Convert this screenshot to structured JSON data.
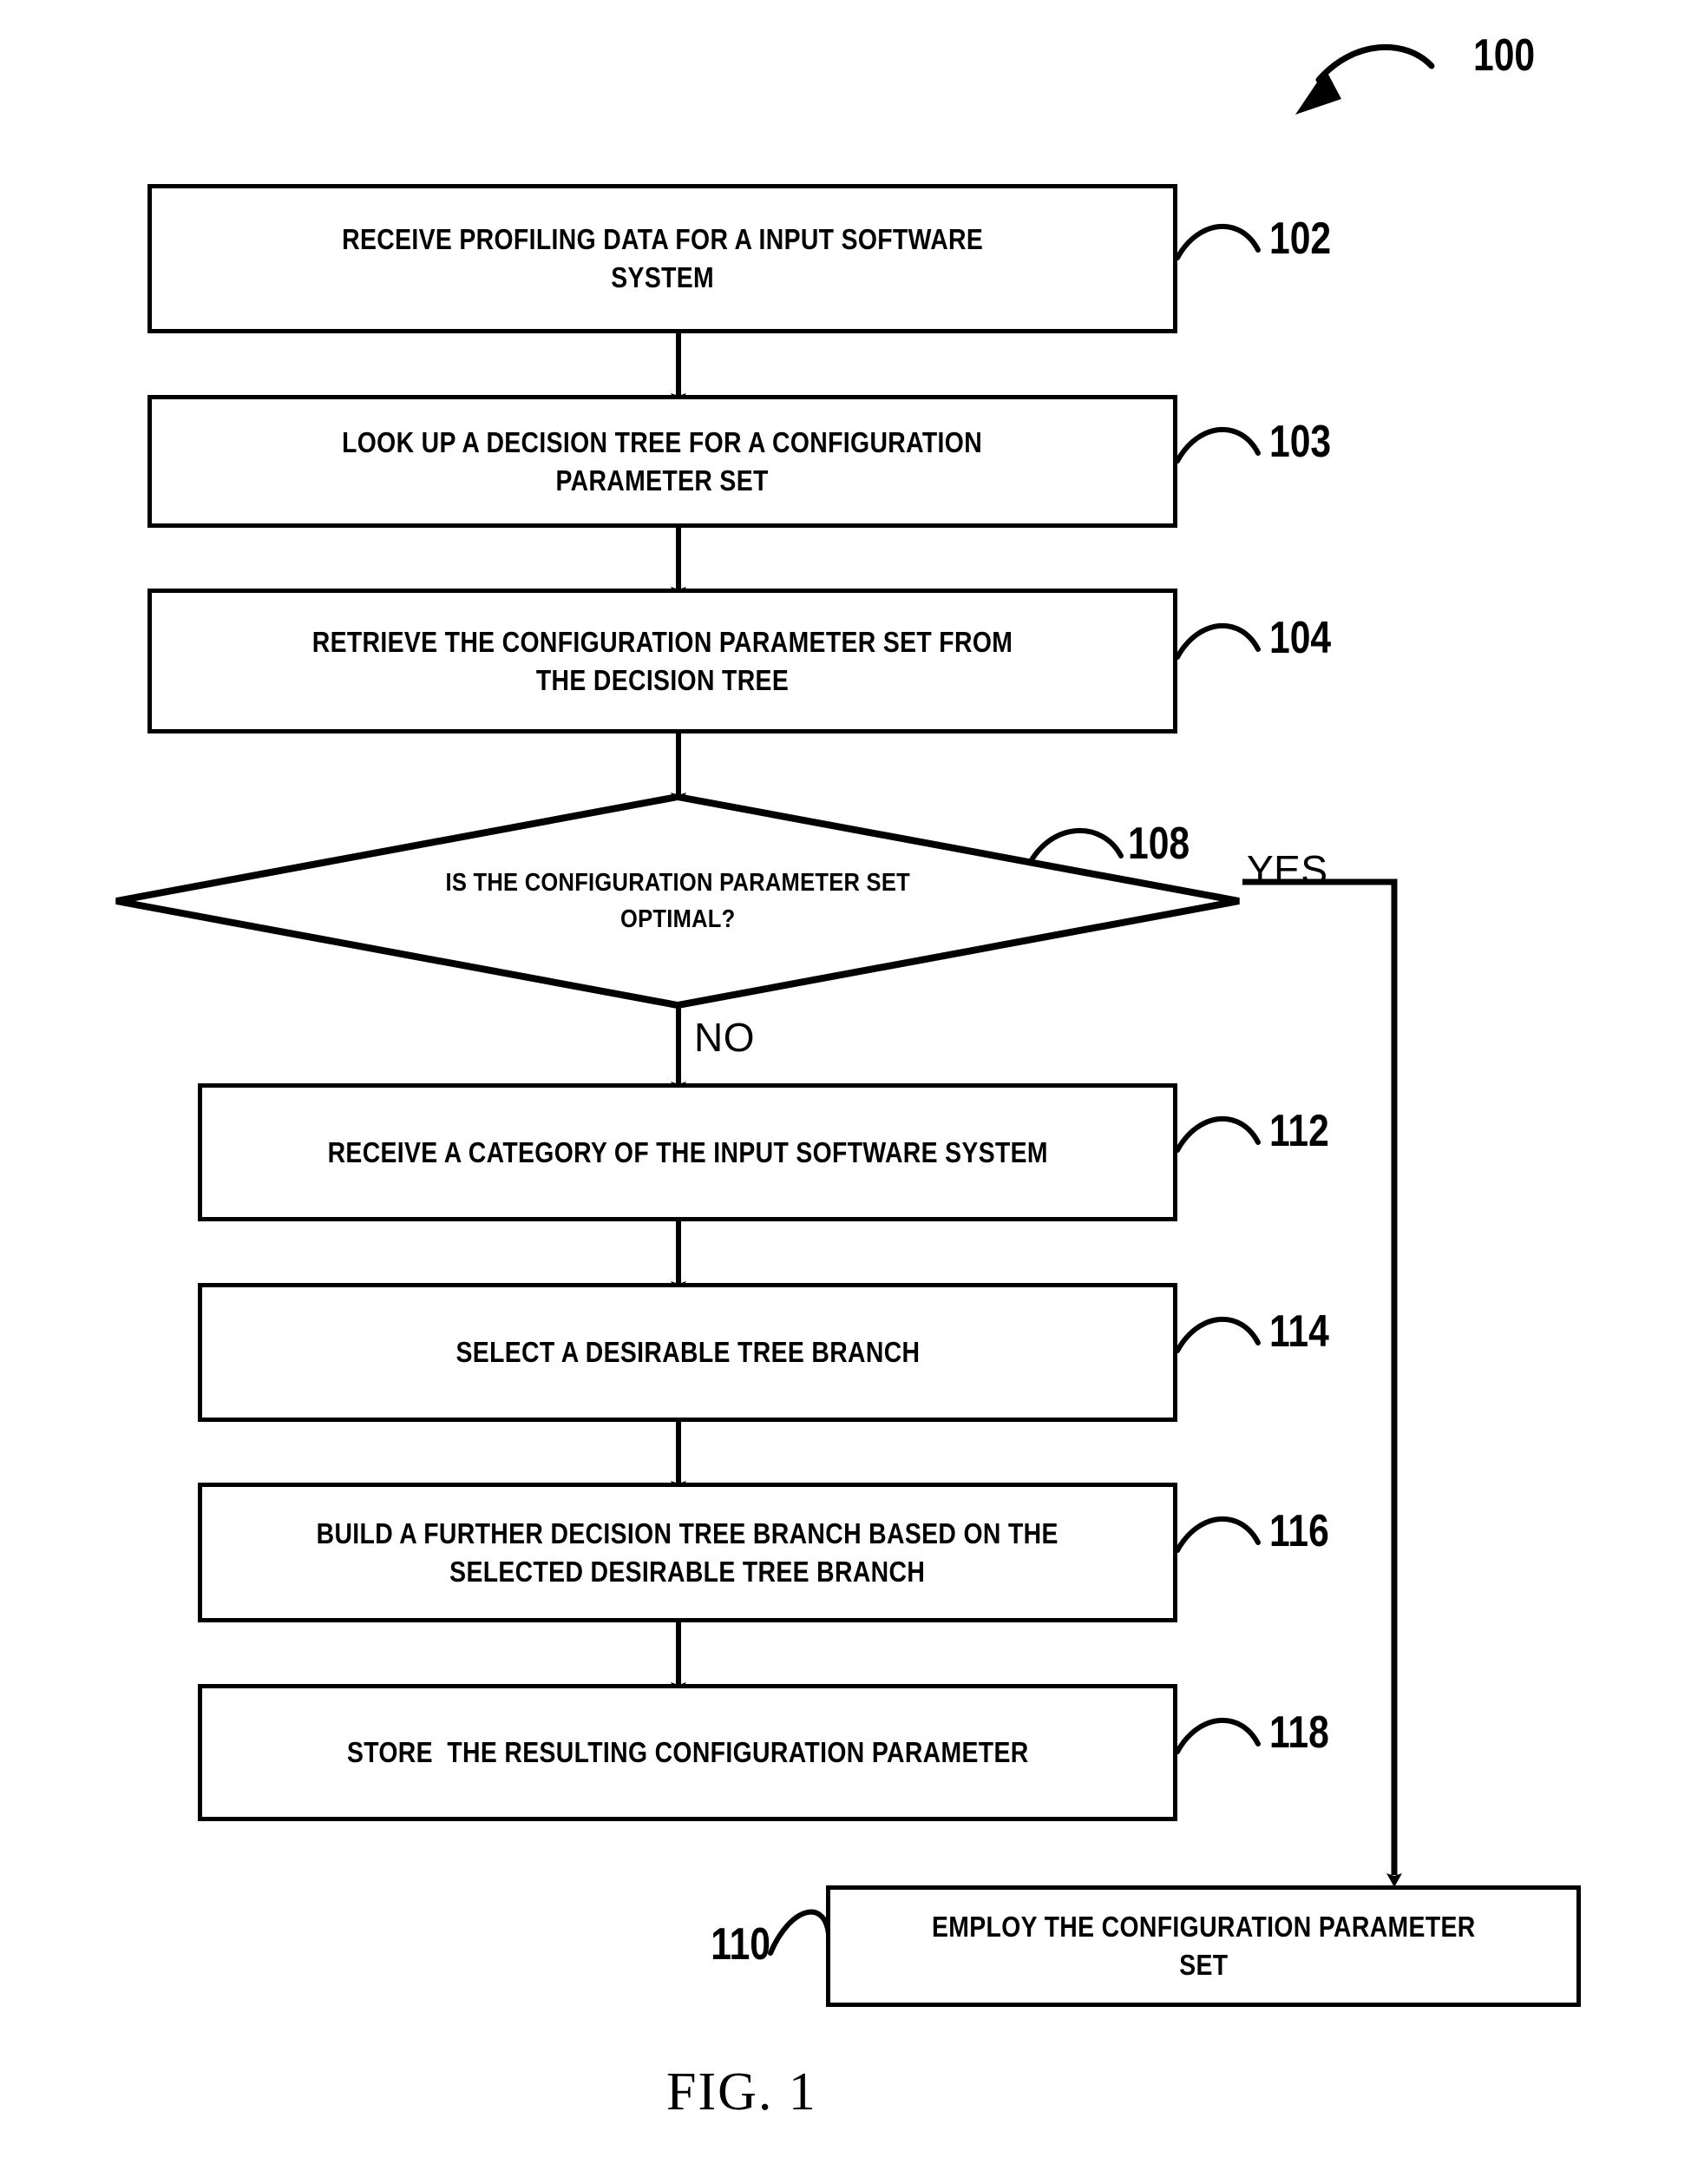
{
  "figure": {
    "caption": "FIG. 1",
    "overall_ref": "100"
  },
  "nodes": [
    {
      "id": "102",
      "type": "process",
      "ref": "102",
      "text": "RECEIVE PROFILING DATA FOR A INPUT SOFTWARE\nSYSTEM"
    },
    {
      "id": "103",
      "type": "process",
      "ref": "103",
      "text": "LOOK UP A DECISION TREE FOR A CONFIGURATION\nPARAMETER SET"
    },
    {
      "id": "104",
      "type": "process",
      "ref": "104",
      "text": "RETRIEVE THE CONFIGURATION PARAMETER SET FROM\nTHE DECISION TREE"
    },
    {
      "id": "108",
      "type": "decision",
      "ref": "108",
      "text": "IS THE CONFIGURATION PARAMETER SET\nOPTIMAL?"
    },
    {
      "id": "112",
      "type": "process",
      "ref": "112",
      "text": "RECEIVE A CATEGORY OF THE INPUT SOFTWARE SYSTEM"
    },
    {
      "id": "114",
      "type": "process",
      "ref": "114",
      "text": "SELECT A DESIRABLE TREE BRANCH"
    },
    {
      "id": "116",
      "type": "process",
      "ref": "116",
      "text": "BUILD A FURTHER DECISION TREE BRANCH BASED ON THE\nSELECTED DESIRABLE TREE BRANCH"
    },
    {
      "id": "118",
      "type": "process",
      "ref": "118",
      "text": "STORE  THE RESULTING CONFIGURATION PARAMETER"
    },
    {
      "id": "110",
      "type": "process",
      "ref": "110",
      "text": "EMPLOY THE CONFIGURATION PARAMETER\nSET"
    }
  ],
  "branches": {
    "yes_label": "YES",
    "no_label": "NO"
  },
  "colors": {
    "stroke": "#000000",
    "background": "#ffffff"
  }
}
